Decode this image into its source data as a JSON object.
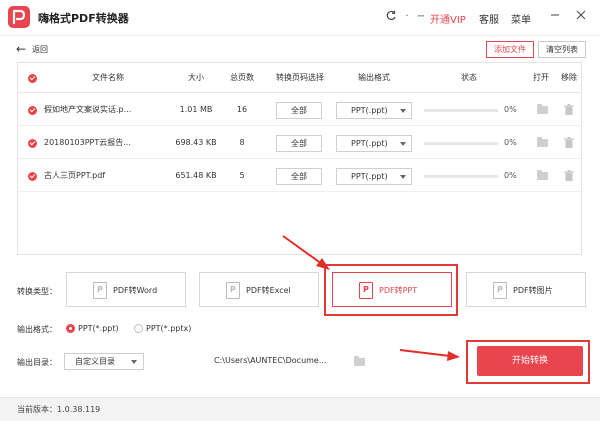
{
  "app": {
    "title": "嗨格式PDF转换器",
    "vip_label": "开通VIP",
    "service_label": "客服",
    "menu_label": "菜单",
    "accent": "#e8454f"
  },
  "toolbar": {
    "back_label": "返回",
    "add_file_label": "添加文件",
    "clear_list_label": "清空列表"
  },
  "table": {
    "headers": {
      "name": "文件名称",
      "size": "大小",
      "pages": "总页数",
      "page_select": "转换页码选择",
      "output_format": "输出格式",
      "status": "状态",
      "open": "打开",
      "remove": "移除"
    },
    "rows": [
      {
        "name": "假如地产文案说实话.p...",
        "size": "1.01 MB",
        "pages": "16",
        "page_btn": "全部",
        "format": "PPT(.ppt)",
        "progress_pct": "0%"
      },
      {
        "name": "20180103PPT云报告...",
        "size": "698.43 KB",
        "pages": "8",
        "page_btn": "全部",
        "format": "PPT(.ppt)",
        "progress_pct": "0%"
      },
      {
        "name": "古人三页PPT.pdf",
        "size": "651.48 KB",
        "pages": "5",
        "page_btn": "全部",
        "format": "PPT(.ppt)",
        "progress_pct": "0%"
      }
    ]
  },
  "conversion": {
    "type_label": "转换类型：",
    "types": [
      "PDF转Word",
      "PDF转Excel",
      "PDF转PPT",
      "PDF转图片"
    ],
    "selected_type": "PDF转PPT"
  },
  "output": {
    "format_label": "输出格式：",
    "format_options": [
      "PPT(*.ppt)",
      "PPT(*.pptx)"
    ],
    "selected_format": "PPT(*.ppt)",
    "dir_label": "输出目录：",
    "dir_select": "自定义目录",
    "dir_path": "C:\\Users\\AUNTEC\\Docume..."
  },
  "start_label": "开始转换",
  "status": {
    "version": "当前版本：1.0.38.119"
  }
}
